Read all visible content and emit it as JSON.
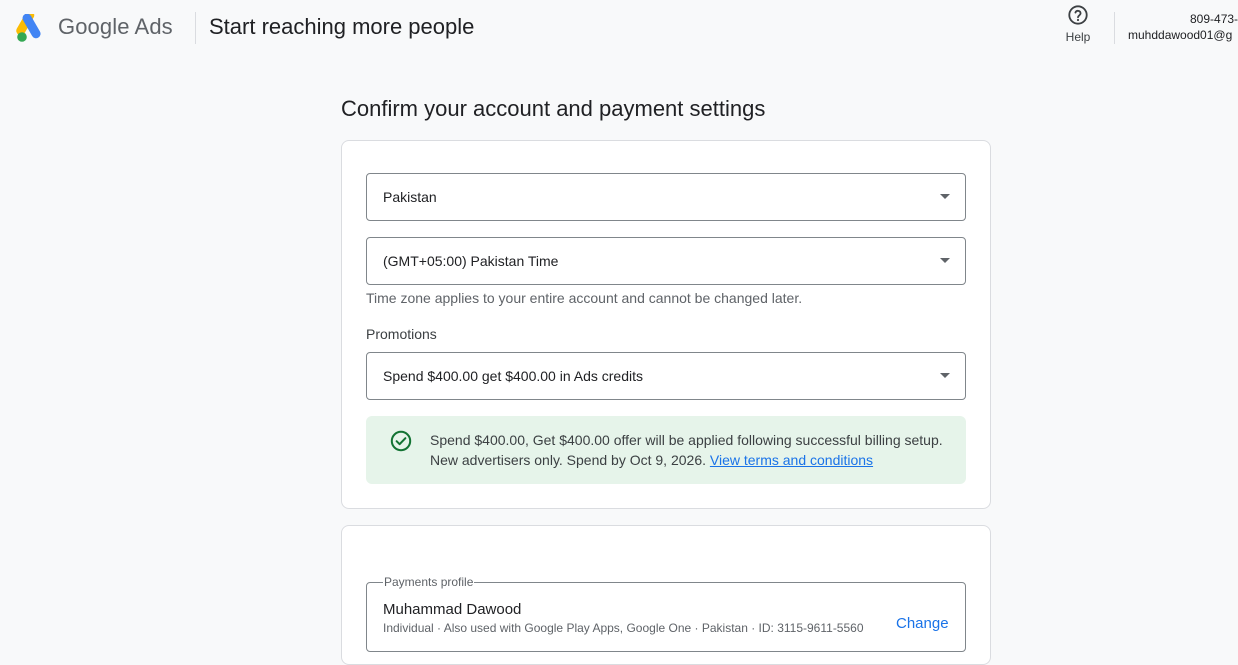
{
  "header": {
    "brand": "Google Ads",
    "title": "Start reaching more people",
    "help_label": "Help",
    "account_id": "809-473-",
    "account_email": "muhddawood01@g"
  },
  "page": {
    "heading": "Confirm your account and payment settings"
  },
  "settings": {
    "country": "Pakistan",
    "timezone": "(GMT+05:00) Pakistan Time",
    "timezone_hint": "Time zone applies to your entire account and cannot be changed later.",
    "promotions_label": "Promotions",
    "promotion": "Spend $400.00 get $400.00 in Ads credits",
    "offer_text": "Spend $400.00, Get $400.00 offer will be applied following successful billing setup. New advertisers only. Spend by Oct 9, 2026.",
    "offer_link": "View terms and conditions"
  },
  "payments": {
    "legend": "Payments profile",
    "name": "Muhammad Dawood",
    "details": "Individual · Also used with Google Play Apps, Google One · Pakistan · ID: 3115-9611-5560",
    "change_label": "Change"
  },
  "colors": {
    "google_blue": "#4285F4",
    "google_yellow": "#FBBC04",
    "google_green": "#34A853",
    "offer_bg": "#e6f4ea",
    "check_green": "#137333",
    "link_blue": "#1a73e8"
  },
  "icons": {
    "logo": "google-ads-logo",
    "help": "help-circle-icon",
    "dropdown": "dropdown-arrow-icon",
    "check": "check-circle-icon"
  }
}
